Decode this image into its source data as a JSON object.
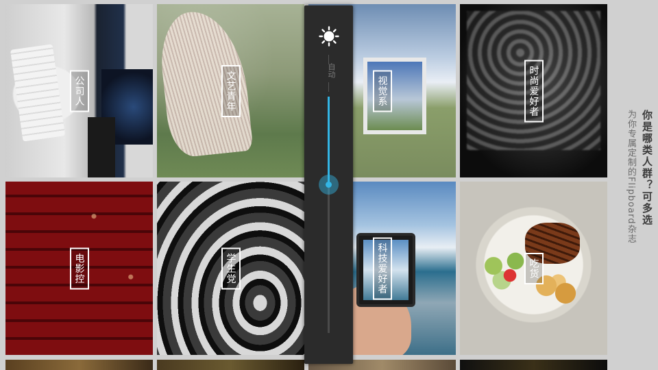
{
  "heading": {
    "title": "你是哪类人群？可多选",
    "subtitle": "为你专属定制的Flipboard杂志"
  },
  "tiles": [
    {
      "label": "公司人"
    },
    {
      "label": "文艺青年"
    },
    {
      "label": "视觉系"
    },
    {
      "label": "时尚爱好者"
    },
    {
      "label": "电影控"
    },
    {
      "label": "学生党"
    },
    {
      "label": "科技爱好者"
    },
    {
      "label": "吃货"
    }
  ],
  "brightness": {
    "icon": "sun-icon",
    "auto_label": "自动",
    "level_fraction": 0.37,
    "accent_color": "#33b5e5"
  }
}
